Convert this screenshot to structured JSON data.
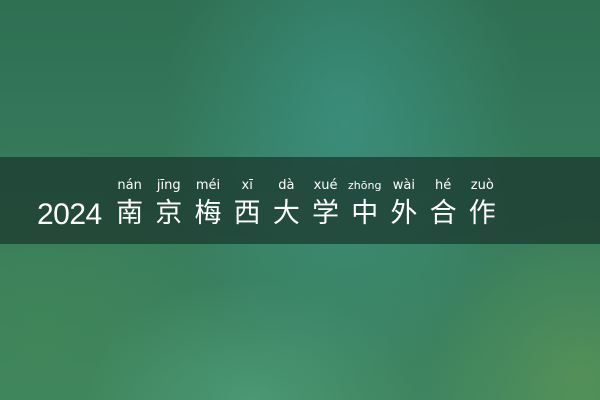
{
  "title": {
    "year": "2024",
    "characters": [
      {
        "pinyin": "nán",
        "hanzi": "南"
      },
      {
        "pinyin": "jīng",
        "hanzi": "京"
      },
      {
        "pinyin": "méi",
        "hanzi": "梅"
      },
      {
        "pinyin": "xī",
        "hanzi": "西"
      },
      {
        "pinyin": "dà",
        "hanzi": "大"
      },
      {
        "pinyin": "xué",
        "hanzi": "学"
      },
      {
        "pinyin": "zhōng",
        "hanzi": "中"
      },
      {
        "pinyin": "wài",
        "hanzi": "外"
      },
      {
        "pinyin": "hé",
        "hanzi": "合"
      },
      {
        "pinyin": "zuò",
        "hanzi": "作"
      }
    ]
  },
  "colors": {
    "banner": "#1a342c",
    "text": "#ffffff",
    "background": "#357a5c"
  }
}
